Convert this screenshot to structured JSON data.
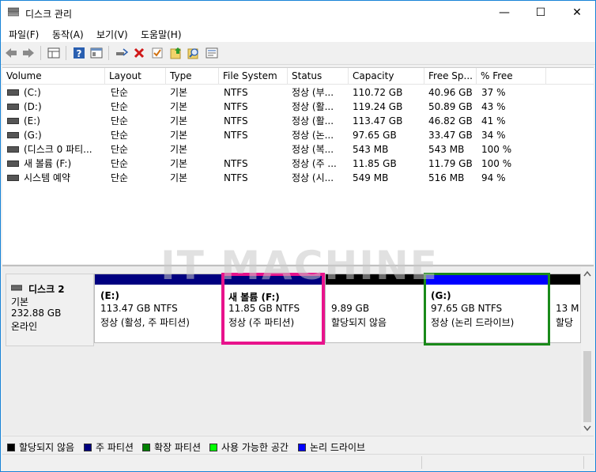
{
  "window": {
    "title": "디스크 관리",
    "min": "—",
    "max": "☐",
    "close": "✕"
  },
  "menu": [
    "파일(F)",
    "동작(A)",
    "보기(V)",
    "도움말(H)"
  ],
  "toolbar": [
    "back-icon",
    "forward-icon",
    "grid-icon",
    "help-icon",
    "console-icon",
    "connect-icon",
    "delete-icon",
    "check-icon",
    "up-icon",
    "search-icon",
    "properties-icon"
  ],
  "columns": [
    "Volume",
    "Layout",
    "Type",
    "File System",
    "Status",
    "Capacity",
    "Free Sp...",
    "% Free"
  ],
  "volumes": [
    {
      "volume": "(C:)",
      "layout": "단순",
      "type": "기본",
      "fs": "NTFS",
      "status": "정상 (부...",
      "capacity": "110.72 GB",
      "free": "40.96 GB",
      "pct": "37 %"
    },
    {
      "volume": "(D:)",
      "layout": "단순",
      "type": "기본",
      "fs": "NTFS",
      "status": "정상 (활...",
      "capacity": "119.24 GB",
      "free": "50.89 GB",
      "pct": "43 %"
    },
    {
      "volume": "(E:)",
      "layout": "단순",
      "type": "기본",
      "fs": "NTFS",
      "status": "정상 (활...",
      "capacity": "113.47 GB",
      "free": "46.82 GB",
      "pct": "41 %"
    },
    {
      "volume": "(G:)",
      "layout": "단순",
      "type": "기본",
      "fs": "NTFS",
      "status": "정상 (논...",
      "capacity": "97.65 GB",
      "free": "33.47 GB",
      "pct": "34 %"
    },
    {
      "volume": "(디스크 0 파티...",
      "layout": "단순",
      "type": "기본",
      "fs": "",
      "status": "정상 (복...",
      "capacity": "543 MB",
      "free": "543 MB",
      "pct": "100 %"
    },
    {
      "volume": "새 볼륨 (F:)",
      "layout": "단순",
      "type": "기본",
      "fs": "NTFS",
      "status": "정상 (주 ...",
      "capacity": "11.85 GB",
      "free": "11.79 GB",
      "pct": "100 %"
    },
    {
      "volume": "시스템 예약",
      "layout": "단순",
      "type": "기본",
      "fs": "NTFS",
      "status": "정상 (시...",
      "capacity": "549 MB",
      "free": "516 MB",
      "pct": "94 %"
    }
  ],
  "disk": {
    "name": "디스크 2",
    "type": "기본",
    "size": "232.88 GB",
    "state": "온라인"
  },
  "partitions": [
    {
      "label": "(E:)",
      "size": "113.47 GB NTFS",
      "status": "정상 (활성, 주 파티션)",
      "color": "#000080"
    },
    {
      "label": "새 볼륨  (F:)",
      "size": "11.85 GB NTFS",
      "status": "정상 (주 파티션)",
      "color": "#000080"
    },
    {
      "label": "",
      "size": "9.89 GB",
      "status": "할당되지 않음",
      "color": "#000000"
    },
    {
      "label": "(G:)",
      "size": "97.65 GB NTFS",
      "status": "정상 (논리 드라이브)",
      "color": "#0000ff"
    },
    {
      "label": "",
      "size": "13 M",
      "status": "할당",
      "color": "#000000"
    }
  ],
  "legend": [
    {
      "label": "할당되지 않음",
      "color": "#000000"
    },
    {
      "label": "주 파티션",
      "color": "#000080"
    },
    {
      "label": "확장 파티션",
      "color": "#008000"
    },
    {
      "label": "사용 가능한 공간",
      "color": "#00ff00"
    },
    {
      "label": "논리 드라이브",
      "color": "#0000ff"
    }
  ],
  "highlights": {
    "f_color": "#e8138c",
    "g_color": "#1a8a1a"
  },
  "watermark": "IT MACHINE"
}
